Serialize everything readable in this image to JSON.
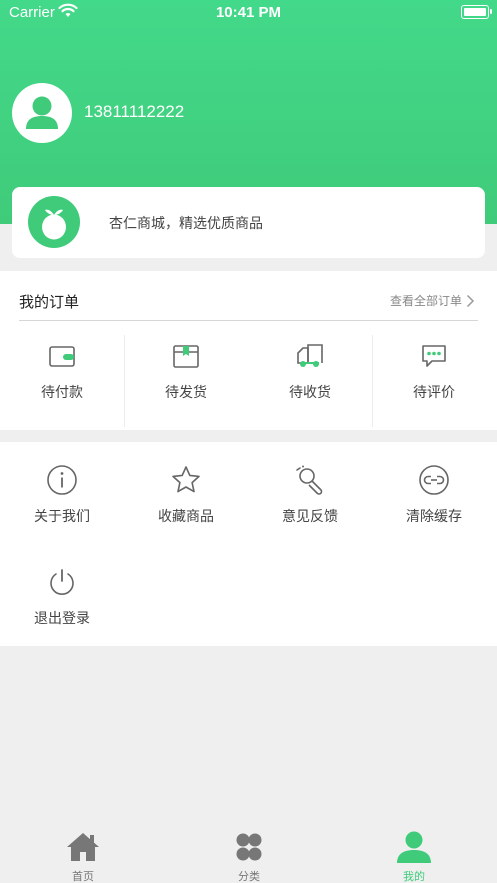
{
  "status_bar": {
    "carrier": "Carrier",
    "time": "10:41 PM"
  },
  "profile": {
    "phone": "13811112222"
  },
  "shop": {
    "slogan": "杏仁商城，精选优质商品"
  },
  "orders": {
    "title": "我的订单",
    "view_all": "查看全部订单",
    "items": [
      {
        "label": "待付款",
        "icon": "wallet-icon"
      },
      {
        "label": "待发货",
        "icon": "package-icon"
      },
      {
        "label": "待收货",
        "icon": "truck-icon"
      },
      {
        "label": "待评价",
        "icon": "comment-icon"
      }
    ]
  },
  "tools": {
    "items": [
      {
        "label": "关于我们",
        "icon": "info-icon"
      },
      {
        "label": "收藏商品",
        "icon": "star-icon"
      },
      {
        "label": "意见反馈",
        "icon": "feedback-icon"
      },
      {
        "label": "清除缓存",
        "icon": "clear-cache-icon"
      },
      {
        "label": "退出登录",
        "icon": "power-icon"
      }
    ]
  },
  "tabbar": {
    "items": [
      {
        "label": "首页",
        "icon": "home-icon"
      },
      {
        "label": "分类",
        "icon": "category-icon"
      },
      {
        "label": "我的",
        "icon": "user-icon",
        "active": true
      }
    ]
  },
  "colors": {
    "accent": "#3fcb7a",
    "background": "#efefef"
  }
}
